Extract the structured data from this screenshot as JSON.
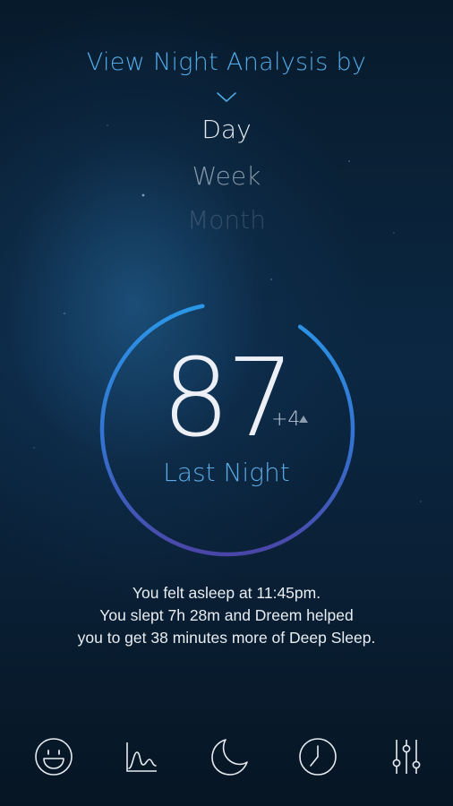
{
  "header": {
    "title": "View Night Analysis by"
  },
  "period_options": [
    {
      "label": "Day",
      "selected": true
    },
    {
      "label": "Week",
      "selected": false
    },
    {
      "label": "Month",
      "selected": false
    }
  ],
  "score": {
    "value": "87",
    "delta": "+4",
    "label": "Last Night",
    "progress": 0.87
  },
  "summary": {
    "line1": "You felt asleep at 11:45pm.",
    "line2": "You slept 7h 28m and Dreem helped",
    "line3": "you to get 38 minutes more of Deep Sleep."
  },
  "nav": {
    "items": [
      {
        "icon": "smiley-icon"
      },
      {
        "icon": "chart-icon"
      },
      {
        "icon": "moon-icon"
      },
      {
        "icon": "clock-icon"
      },
      {
        "icon": "sliders-icon"
      }
    ]
  },
  "colors": {
    "accent": "#52a9e5",
    "ring_start": "#2a97e8",
    "ring_end": "#4a46a8"
  }
}
